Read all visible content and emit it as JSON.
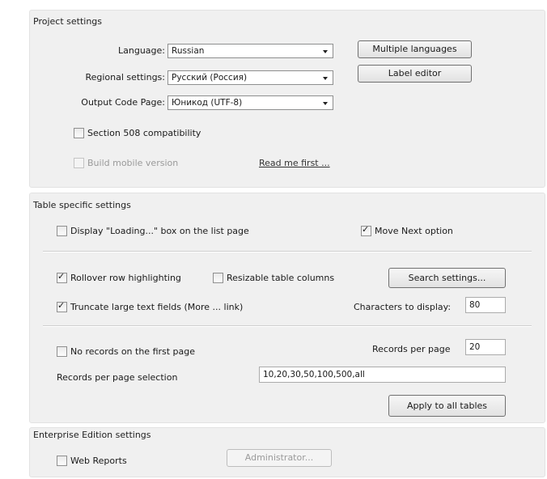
{
  "project": {
    "title": "Project settings",
    "language_label": "Language:",
    "language_value": "Russian",
    "regional_label": "Regional settings:",
    "regional_value": "Русский (Россия)",
    "codepage_label": "Output Code Page:",
    "codepage_value": "Юникод (UTF-8)",
    "multiple_languages": "Multiple languages",
    "label_editor": "Label editor",
    "section508_label": "Section 508 compatibility",
    "section508_checked": false,
    "mobile_label": "Build mobile version",
    "mobile_checked": false,
    "read_me_first": "Read me first ..."
  },
  "table": {
    "title": "Table specific settings",
    "loading_label": "Display \"Loading...\" box on the list page",
    "loading_checked": false,
    "move_next_label": "Move Next option",
    "move_next_checked": true,
    "rollover_label": "Rollover row highlighting",
    "rollover_checked": true,
    "resizable_label": "Resizable table columns",
    "resizable_checked": false,
    "search_settings": "Search settings...",
    "truncate_label": "Truncate large text fields (More ... link)",
    "truncate_checked": true,
    "chars_label": "Characters to display:",
    "chars_value": "80",
    "no_records_label": "No records on the first page",
    "no_records_checked": false,
    "records_per_page_label": "Records per page",
    "records_per_page_value": "20",
    "rpp_selection_label": "Records per page selection",
    "rpp_selection_value": "10,20,30,50,100,500,all",
    "apply_all": "Apply to all tables"
  },
  "enterprise": {
    "title": "Enterprise Edition settings",
    "web_reports_label": "Web Reports",
    "web_reports_checked": false,
    "administrator": "Administrator..."
  }
}
